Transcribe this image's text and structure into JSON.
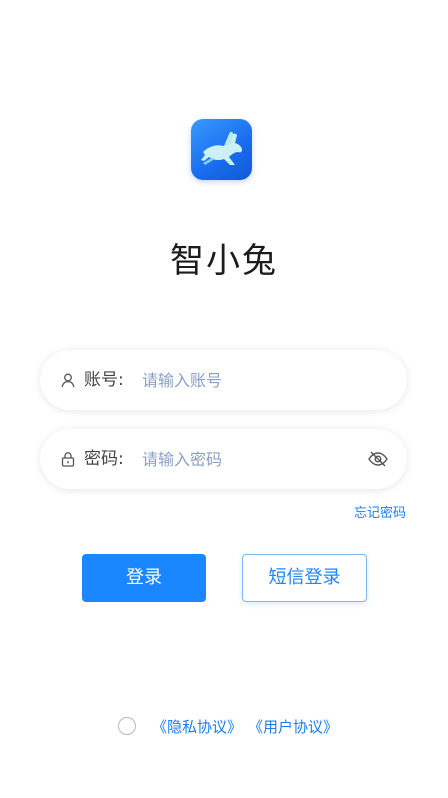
{
  "app": {
    "title": "智小兔",
    "logo_icon": "rabbit-icon",
    "accent_color": "#1a86ff"
  },
  "account_field": {
    "label": "账号:",
    "placeholder": "请输入账号",
    "value": "",
    "icon": "user-icon"
  },
  "password_field": {
    "label": "密码:",
    "placeholder": "请输入密码",
    "value": "",
    "icon": "lock-icon",
    "toggle_icon": "eye-off-icon"
  },
  "forgot_password": "忘记密码",
  "buttons": {
    "login": "登录",
    "sms_login": "短信登录"
  },
  "agreement": {
    "checked": false,
    "privacy": "《隐私协议》",
    "user": "《用户协议》"
  }
}
